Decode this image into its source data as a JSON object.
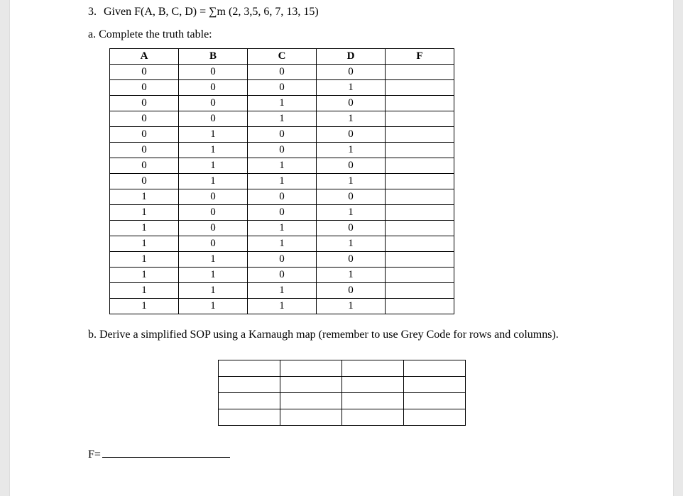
{
  "question": {
    "number": "3.",
    "text": "Given F(A, B, C, D) = ∑m (2, 3,5, 6, 7, 13, 15)"
  },
  "part_a": {
    "label": "a. Complete the truth table:",
    "headers": [
      "A",
      "B",
      "C",
      "D",
      "F"
    ],
    "rows": [
      [
        "0",
        "0",
        "0",
        "0",
        ""
      ],
      [
        "0",
        "0",
        "0",
        "1",
        ""
      ],
      [
        "0",
        "0",
        "1",
        "0",
        ""
      ],
      [
        "0",
        "0",
        "1",
        "1",
        ""
      ],
      [
        "0",
        "1",
        "0",
        "0",
        ""
      ],
      [
        "0",
        "1",
        "0",
        "1",
        ""
      ],
      [
        "0",
        "1",
        "1",
        "0",
        ""
      ],
      [
        "0",
        "1",
        "1",
        "1",
        ""
      ],
      [
        "1",
        "0",
        "0",
        "0",
        ""
      ],
      [
        "1",
        "0",
        "0",
        "1",
        ""
      ],
      [
        "1",
        "0",
        "1",
        "0",
        ""
      ],
      [
        "1",
        "0",
        "1",
        "1",
        ""
      ],
      [
        "1",
        "1",
        "0",
        "0",
        ""
      ],
      [
        "1",
        "1",
        "0",
        "1",
        ""
      ],
      [
        "1",
        "1",
        "1",
        "0",
        ""
      ],
      [
        "1",
        "1",
        "1",
        "1",
        ""
      ]
    ]
  },
  "part_b": {
    "label": "b. Derive a simplified SOP using a Karnaugh map (remember to use Grey Code for rows and columns)."
  },
  "answer": {
    "prefix": "F="
  }
}
